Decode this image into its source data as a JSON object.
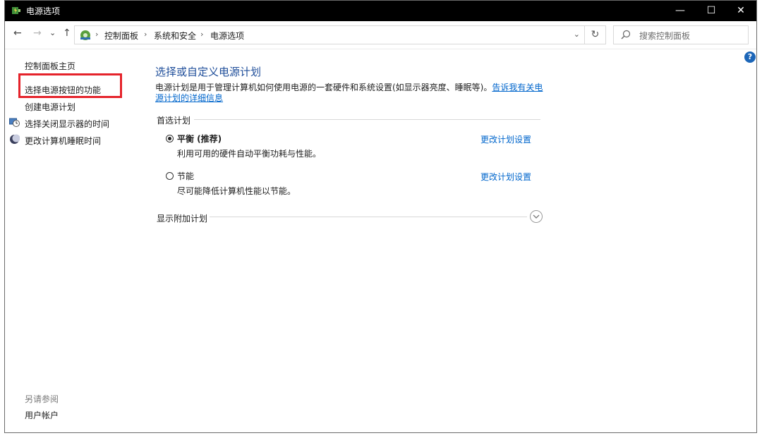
{
  "window": {
    "title": "电源选项",
    "minimize": "—",
    "maximize": "☐",
    "close": "✕"
  },
  "nav": {
    "back": "←",
    "forward": "→",
    "recent": "⌄",
    "up": "↑"
  },
  "breadcrumb": {
    "items": [
      "控制面板",
      "系统和安全",
      "电源选项"
    ],
    "separator": "›",
    "dropdown": "⌄"
  },
  "refresh": "↻",
  "search": {
    "placeholder": "搜索控制面板"
  },
  "help": "?",
  "sidebar": {
    "items": [
      {
        "label": "控制面板主页"
      },
      {
        "label": "选择电源按钮的功能"
      },
      {
        "label": "创建电源计划"
      },
      {
        "label": "选择关闭显示器的时间"
      },
      {
        "label": "更改计算机睡眠时间"
      }
    ],
    "see_also_heading": "另请参阅",
    "see_also_items": [
      {
        "label": "用户帐户"
      }
    ]
  },
  "main": {
    "title": "选择或自定义电源计划",
    "description": "电源计划是用于管理计算机如何使用电源的一套硬件和系统设置(如显示器亮度、睡眠等)。",
    "description_link": "告诉我有关电源计划的详细信息",
    "preferred_label": "首选计划",
    "plans": [
      {
        "name": "平衡 (推荐)",
        "description": "利用可用的硬件自动平衡功耗与性能。",
        "link": "更改计划设置",
        "selected": true
      },
      {
        "name": "节能",
        "description": "尽可能降低计算机性能以节能。",
        "link": "更改计划设置",
        "selected": false
      }
    ],
    "additional_label": "显示附加计划"
  },
  "colors": {
    "title_blue": "#1f4e9a",
    "link_blue": "#0066cc",
    "highlight_red": "#e5232b",
    "titlebar": "#000000"
  }
}
